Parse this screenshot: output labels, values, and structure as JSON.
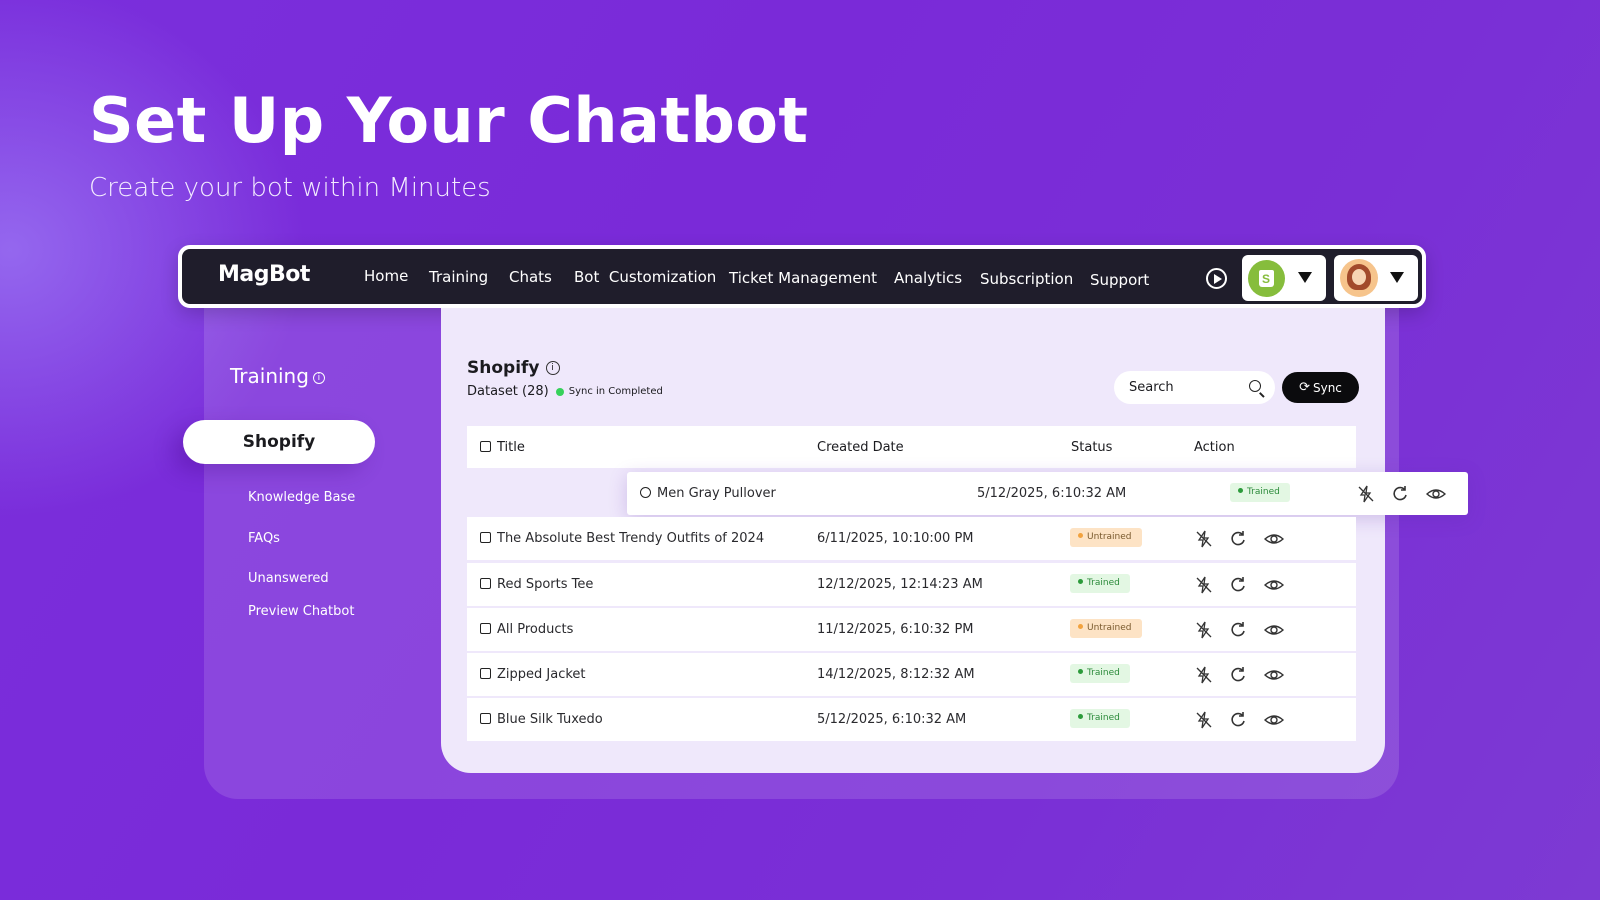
{
  "hero": {
    "title": "Set Up Your Chatbot",
    "subtitle": "Create your bot within Minutes"
  },
  "navbar": {
    "logo": "MagBot",
    "items": [
      "Home",
      "Training",
      "Chats",
      "Bot  Customization",
      "Ticket Management",
      "Analytics",
      "Subscription",
      "Support"
    ],
    "play_icon": "play-circle-icon",
    "store_icon": "shopify-bag-icon",
    "avatar_icon": "user-avatar"
  },
  "sidebar": {
    "title": "Training",
    "active_item": "Shopify",
    "items": [
      "Knowledge Base",
      "FAQs",
      "Unanswered",
      "Preview Chatbot"
    ]
  },
  "main": {
    "title": "Shopify",
    "dataset": "Dataset (28)",
    "sync_status": "Sync in Completed",
    "search_placeholder": "Search",
    "sync_button": "Sync",
    "columns": [
      "Title",
      "Created Date",
      "Status",
      "Action"
    ],
    "rows": [
      {
        "title": "Men Gray Pullover",
        "date": "5/12/2025, 6:10:32 AM",
        "status": "Trained"
      },
      {
        "title": "The Absolute Best Trendy Outfits of 2024",
        "date": "6/11/2025, 10:10:00 PM",
        "status": "Untrained"
      },
      {
        "title": "Red Sports Tee",
        "date": "12/12/2025, 12:14:23 AM",
        "status": "Trained"
      },
      {
        "title": "All Products",
        "date": "11/12/2025, 6:10:32 PM",
        "status": "Untrained"
      },
      {
        "title": "Zipped Jacket",
        "date": "14/12/2025, 8:12:32 AM",
        "status": "Trained"
      },
      {
        "title": "Blue Silk Tuxedo",
        "date": "5/12/2025, 6:10:32 AM",
        "status": "Trained"
      }
    ]
  },
  "colors": {
    "background": "#7a2ad8",
    "navbar": "#1f1d2b",
    "trained": "#2c8b3b",
    "untrained": "#f2a23e",
    "sync_dot": "#36d15a"
  }
}
